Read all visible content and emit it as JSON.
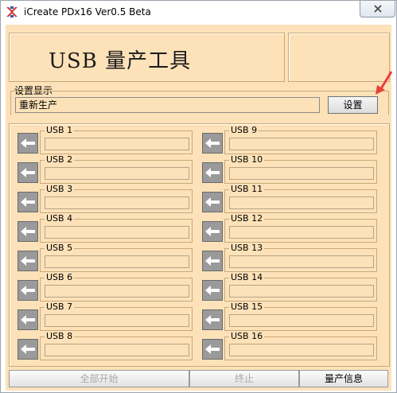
{
  "window": {
    "title": "iCreate PDx16 Ver0.5 Beta"
  },
  "header": {
    "title": "USB 量产工具"
  },
  "settings": {
    "group_label": "设置显示",
    "value": "重新生产",
    "button_label": "设置"
  },
  "usb_left": [
    {
      "label": "USB 1"
    },
    {
      "label": "USB 2"
    },
    {
      "label": "USB 3"
    },
    {
      "label": "USB 4"
    },
    {
      "label": "USB 5"
    },
    {
      "label": "USB 6"
    },
    {
      "label": "USB 7"
    },
    {
      "label": "USB 8"
    }
  ],
  "usb_right": [
    {
      "label": "USB 9"
    },
    {
      "label": "USB 10"
    },
    {
      "label": "USB 11"
    },
    {
      "label": "USB 12"
    },
    {
      "label": "USB 13"
    },
    {
      "label": "USB 14"
    },
    {
      "label": "USB 15"
    },
    {
      "label": "USB 16"
    }
  ],
  "footer": {
    "start_all": "全部开始",
    "stop": "终止",
    "production_info": "量产信息"
  },
  "colors": {
    "panel": "#fde2b9",
    "arrow_accent": "#e8403a"
  }
}
